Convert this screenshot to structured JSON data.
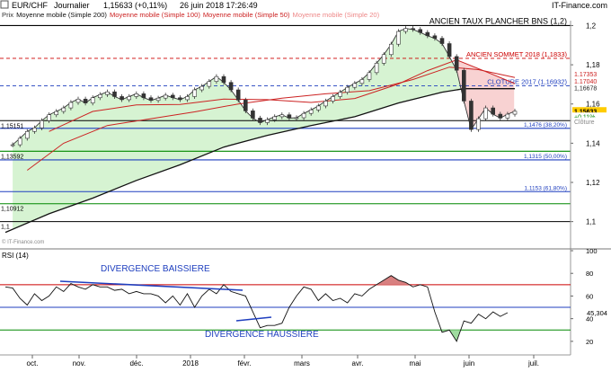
{
  "header": {
    "symbol": "EUR/CHF",
    "period": "Journalier",
    "quote": "1,15633 (+0,11%)",
    "datetime": "26 juin 2018 17:26:49",
    "brand": "IT-Finance.com"
  },
  "legend": [
    {
      "label": "Prix",
      "color": "#333333"
    },
    {
      "label": "Moyenne mobile (Simple 200)",
      "color": "#111111"
    },
    {
      "label": "Moyenne mobile (Simple 100)",
      "color": "#cc2222"
    },
    {
      "label": "Moyenne mobile (Simple 50)",
      "color": "#cc2222"
    },
    {
      "label": "Moyenne mobile (Simple 20)",
      "color": "#ee8888"
    }
  ],
  "price_levels": [
    {
      "label": "ANCIEN TAUX PLANCHER BNS (1,2)",
      "value": 1.2,
      "color": "#000000",
      "style": "solid"
    },
    {
      "label": "ANCIEN SOMMET 2018 (1,1833)",
      "value": 1.1833,
      "color": "#cc0000",
      "style": "dashed"
    },
    {
      "label": "CLOTURE 2017 (1,16932)",
      "value": 1.16932,
      "color": "#1f3fbf",
      "style": "dashed"
    },
    {
      "label": "1,1476 (38,20%)",
      "value": 1.1476,
      "color": "#1f3fbf",
      "style": "solid"
    },
    {
      "label": "1,1315 (50,00%)",
      "value": 1.1315,
      "color": "#1f3fbf",
      "style": "solid"
    },
    {
      "label": "1,1153 (61,80%)",
      "value": 1.1153,
      "color": "#1f3fbf",
      "style": "solid"
    },
    {
      "label": "1,15151",
      "value": 1.15151,
      "color": "#000000",
      "style": "solid"
    },
    {
      "label": "1,13592",
      "value": 1.13592,
      "color": "#008800",
      "style": "solid"
    },
    {
      "label": "1,10912",
      "value": 1.10912,
      "color": "#008800",
      "style": "solid"
    },
    {
      "label": "1,1",
      "value": 1.1,
      "color": "#000000",
      "style": "solid"
    }
  ],
  "right_value_boxes": [
    {
      "text": "1,17353",
      "value": 1.1755,
      "bg": "#ffffff",
      "color": "#cc2222"
    },
    {
      "text": "1,17040",
      "value": 1.1719,
      "bg": "#ffffff",
      "color": "#cc2222"
    },
    {
      "text": "1,16678",
      "value": 1.1683,
      "bg": "#ffffff",
      "color": "#222222"
    },
    {
      "text": "1,15633",
      "value": 1.15633,
      "bg": "#ffcc00",
      "color": "#000000"
    },
    {
      "text": "+0,11%",
      "value": 1.1536,
      "bg": "#ffffff",
      "color": "#008800"
    },
    {
      "text": "Clôture",
      "value": 1.1511,
      "bg": "#ffffff",
      "color": "#888888"
    }
  ],
  "watermark": "© IT-Finance.com",
  "rsi_panel": {
    "title": "RSI (14)",
    "last_value": "45,304",
    "levels": [
      {
        "value": 70,
        "color": "#cc0000"
      },
      {
        "value": 50,
        "color": "#1f3fbf"
      },
      {
        "value": 30,
        "color": "#008800"
      }
    ],
    "annotations": [
      {
        "text": "DIVERGENCE BAISSIERE",
        "color": "#1f3fbf"
      },
      {
        "text": "DIVERGENCE HAUSSIERE",
        "color": "#1f3fbf"
      }
    ]
  },
  "chart_data": {
    "type": "line",
    "x_ticks": [
      "oct.",
      "nov.",
      "déc.",
      "2018",
      "févr.",
      "mars",
      "avr.",
      "mai",
      "juin",
      "juil."
    ],
    "y_ticks": [
      "1,2",
      "1,18",
      "1,16",
      "1,14",
      "1,12",
      "1,1"
    ],
    "ylim": [
      1.0925,
      1.2025
    ],
    "rsi_ticks": [
      "100",
      "80",
      "60",
      "40",
      "20"
    ],
    "rsi_ylim": [
      8,
      100
    ],
    "rsi_values": [
      68,
      67,
      58,
      52,
      62,
      56,
      60,
      68,
      64,
      71,
      68,
      66,
      70,
      68,
      68,
      65,
      66,
      62,
      64,
      62,
      62,
      60,
      54,
      60,
      52,
      62,
      50,
      60,
      66,
      62,
      70,
      64,
      62,
      60,
      46,
      32,
      34,
      34,
      36,
      50,
      60,
      68,
      66,
      56,
      62,
      56,
      58,
      54,
      62,
      60,
      66,
      70,
      74,
      78,
      74,
      72,
      68,
      70,
      68,
      46,
      28,
      30,
      20,
      38,
      36,
      44,
      40,
      46,
      42,
      45.3
    ],
    "series": [
      {
        "name": "Prix",
        "points": [
          [
            1,
            1.1392
          ],
          [
            2,
            1.1425
          ],
          [
            3,
            1.146
          ],
          [
            4,
            1.1478
          ],
          [
            5,
            1.1515
          ],
          [
            6,
            1.1545
          ],
          [
            7,
            1.1562
          ],
          [
            8,
            1.158
          ],
          [
            9,
            1.1608
          ],
          [
            10,
            1.1625
          ],
          [
            11,
            1.1605
          ],
          [
            12,
            1.1632
          ],
          [
            13,
            1.1648
          ],
          [
            14,
            1.1662
          ],
          [
            15,
            1.1638
          ],
          [
            16,
            1.1622
          ],
          [
            17,
            1.1638
          ],
          [
            18,
            1.1652
          ],
          [
            19,
            1.1632
          ],
          [
            20,
            1.1618
          ],
          [
            21,
            1.163
          ],
          [
            22,
            1.1645
          ],
          [
            23,
            1.1632
          ],
          [
            24,
            1.1622
          ],
          [
            25,
            1.1638
          ],
          [
            26,
            1.1672
          ],
          [
            27,
            1.169
          ],
          [
            28,
            1.1715
          ],
          [
            29,
            1.174
          ],
          [
            30,
            1.171
          ],
          [
            31,
            1.1672
          ],
          [
            32,
            1.162
          ],
          [
            33,
            1.1565
          ],
          [
            34,
            1.1528
          ],
          [
            35,
            1.1505
          ],
          [
            36,
            1.152
          ],
          [
            37,
            1.1535
          ],
          [
            38,
            1.1545
          ],
          [
            39,
            1.1528
          ],
          [
            40,
            1.153
          ],
          [
            41,
            1.1552
          ],
          [
            42,
            1.157
          ],
          [
            43,
            1.159
          ],
          [
            44,
            1.1615
          ],
          [
            45,
            1.1638
          ],
          [
            46,
            1.166
          ],
          [
            47,
            1.1685
          ],
          [
            48,
            1.1705
          ],
          [
            49,
            1.1725
          ],
          [
            50,
            1.176
          ],
          [
            51,
            1.1808
          ],
          [
            52,
            1.1852
          ],
          [
            53,
            1.1905
          ],
          [
            54,
            1.197
          ],
          [
            55,
            1.1985
          ],
          [
            56,
            1.198
          ],
          [
            57,
            1.1965
          ],
          [
            58,
            1.1948
          ],
          [
            59,
            1.1935
          ],
          [
            60,
            1.1908
          ],
          [
            61,
            1.1842
          ],
          [
            62,
            1.1772
          ],
          [
            63,
            1.1615
          ],
          [
            64,
            1.147
          ],
          [
            65,
            1.1525
          ],
          [
            66,
            1.158
          ],
          [
            67,
            1.1548
          ],
          [
            68,
            1.1528
          ],
          [
            69,
            1.1548
          ],
          [
            70,
            1.1563
          ]
        ],
        "color": "#333333"
      },
      {
        "name": "Moyenne mobile (Simple 200)",
        "points": [
          [
            0,
            1.0945
          ],
          [
            6,
            1.104
          ],
          [
            12,
            1.112
          ],
          [
            18,
            1.121
          ],
          [
            24,
            1.129
          ],
          [
            30,
            1.138
          ],
          [
            36,
            1.144
          ],
          [
            42,
            1.149
          ],
          [
            48,
            1.1535
          ],
          [
            54,
            1.1605
          ],
          [
            60,
            1.166
          ],
          [
            63,
            1.1678
          ],
          [
            70,
            1.1678
          ]
        ],
        "color": "#111111"
      },
      {
        "name": "Moyenne mobile (Simple 100)",
        "points": [
          [
            3,
            1.1262
          ],
          [
            8,
            1.14
          ],
          [
            14,
            1.149
          ],
          [
            20,
            1.1525
          ],
          [
            26,
            1.156
          ],
          [
            32,
            1.16
          ],
          [
            38,
            1.163
          ],
          [
            44,
            1.1652
          ],
          [
            50,
            1.1668
          ],
          [
            56,
            1.1725
          ],
          [
            61,
            1.1788
          ],
          [
            65,
            1.1775
          ],
          [
            70,
            1.1735
          ]
        ],
        "color": "#cc2222"
      },
      {
        "name": "Moyenne mobile (Simple 50)",
        "points": [
          [
            6,
            1.146
          ],
          [
            12,
            1.1562
          ],
          [
            18,
            1.1595
          ],
          [
            24,
            1.1598
          ],
          [
            30,
            1.1625
          ],
          [
            36,
            1.1622
          ],
          [
            42,
            1.1608
          ],
          [
            48,
            1.1628
          ],
          [
            54,
            1.1702
          ],
          [
            58,
            1.177
          ],
          [
            62,
            1.1825
          ],
          [
            66,
            1.1765
          ],
          [
            70,
            1.1704
          ]
        ],
        "color": "#cc2222"
      }
    ]
  }
}
